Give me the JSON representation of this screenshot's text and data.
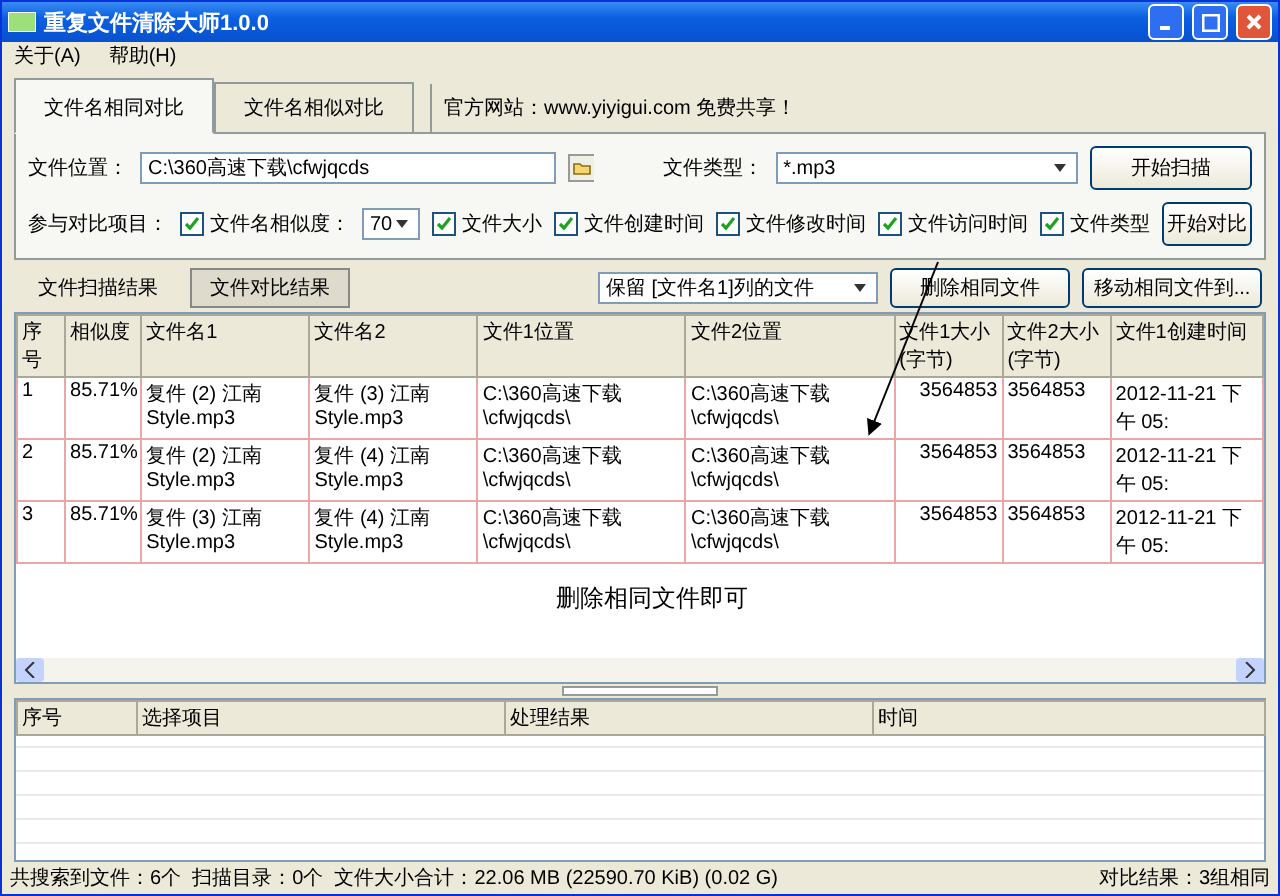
{
  "window": {
    "title": "重复文件清除大师1.0.0"
  },
  "menu": [
    "关于(A)",
    "帮助(H)"
  ],
  "mode_tabs": [
    {
      "label": "文件名相同对比",
      "selected": true
    },
    {
      "label": "文件名相似对比",
      "selected": false
    }
  ],
  "website": "官方网站：www.yiyigui.com 免费共享！",
  "location": {
    "label": "文件位置：",
    "value": "C:\\360高速下载\\cfwjqcds"
  },
  "file_type": {
    "label": "文件类型：",
    "value": "*.mp3"
  },
  "compare": {
    "label": "参与对比项目：",
    "similarity": "70",
    "options": [
      {
        "label": "文件名相似度：",
        "checked": true
      },
      {
        "label": "文件大小",
        "checked": true
      },
      {
        "label": "文件创建时间",
        "checked": true
      },
      {
        "label": "文件修改时间",
        "checked": true
      },
      {
        "label": "文件访问时间",
        "checked": true
      },
      {
        "label": "文件类型",
        "checked": true
      }
    ]
  },
  "buttons": [
    "开始扫描",
    "开始对比"
  ],
  "result_tabs": [
    {
      "label": "文件扫描结果",
      "selected": false
    },
    {
      "label": "文件对比结果",
      "selected": true
    }
  ],
  "keep_select": "保留 [文件名1]列的文件",
  "actions": [
    "删除相同文件",
    "移动相同文件到..."
  ],
  "table": {
    "columns": [
      "序号",
      "相似度",
      "文件名1",
      "文件名2",
      "文件1位置",
      "文件2位置",
      "文件1大小(字节)",
      "文件2大小(字节)",
      "文件1创建时间"
    ],
    "rows": [
      [
        "1",
        "85.71%",
        "复件 (2) 江南Style.mp3",
        "复件 (3) 江南Style.mp3",
        "C:\\360高速下载\\cfwjqcds\\",
        "C:\\360高速下载\\cfwjqcds\\",
        "3564853",
        "3564853",
        "2012-11-21 下午 05:"
      ],
      [
        "2",
        "85.71%",
        "复件 (2) 江南Style.mp3",
        "复件 (4) 江南Style.mp3",
        "C:\\360高速下载\\cfwjqcds\\",
        "C:\\360高速下载\\cfwjqcds\\",
        "3564853",
        "3564853",
        "2012-11-21 下午 05:"
      ],
      [
        "3",
        "85.71%",
        "复件 (3) 江南Style.mp3",
        "复件 (4) 江南Style.mp3",
        "C:\\360高速下载\\cfwjqcds\\",
        "C:\\360高速下载\\cfwjqcds\\",
        "3564853",
        "3564853",
        "2012-11-21 下午 05:"
      ]
    ]
  },
  "annotation": "删除相同文件即可",
  "log_table": {
    "columns": [
      "序号",
      "选择项目",
      "处理结果",
      "时间"
    ]
  },
  "status_bar": {
    "left": "共搜索到文件：6个  扫描目录：0个  文件大小合计：22.06 MB (22590.70 KiB) (0.02 G)",
    "right": "对比结果：3组相同"
  }
}
